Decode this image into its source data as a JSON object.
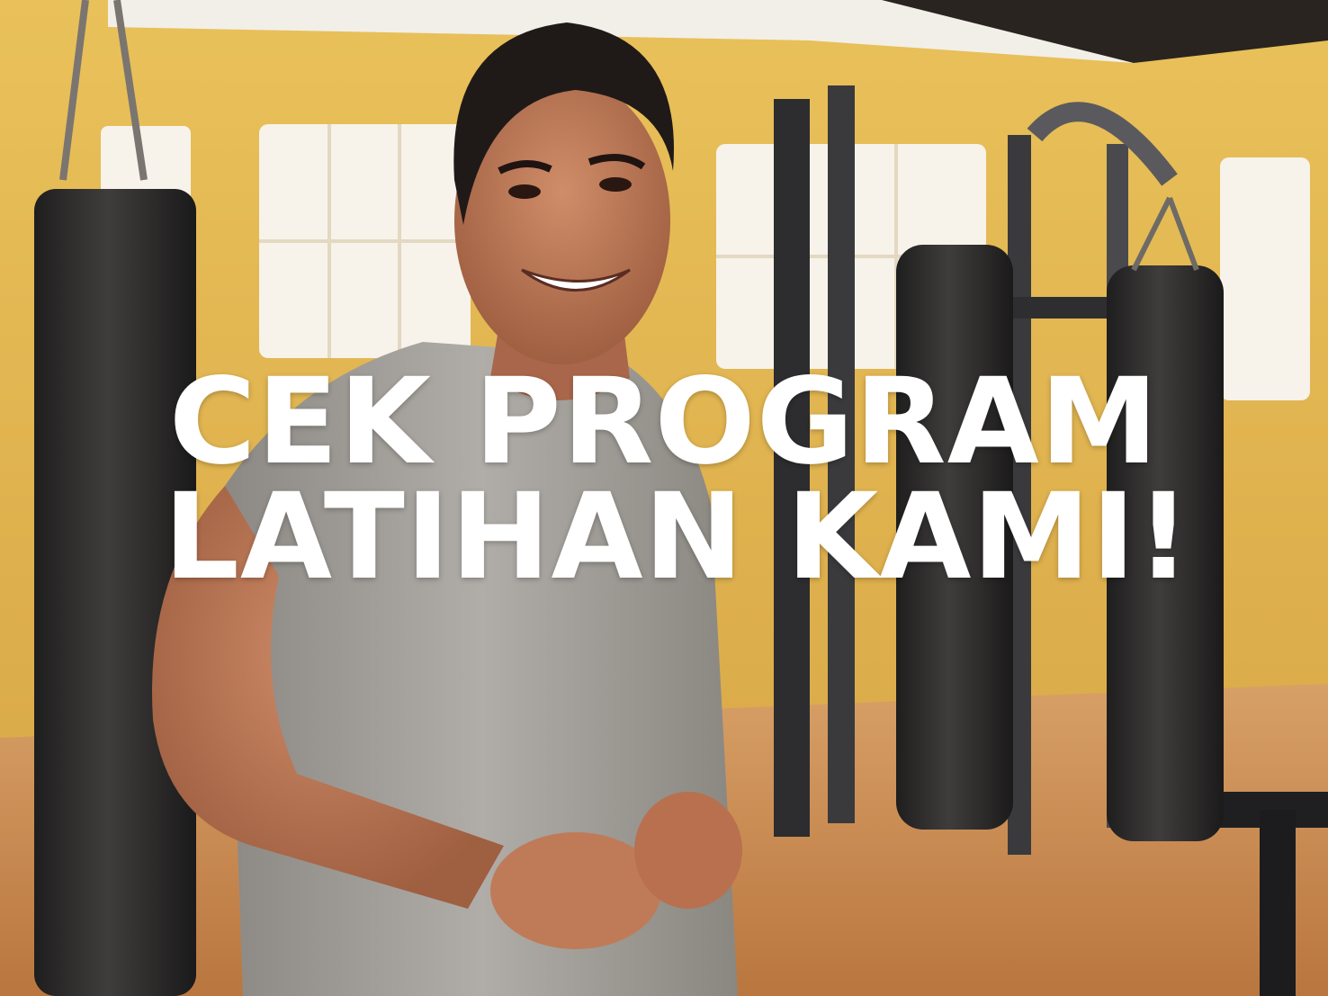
{
  "headline": {
    "line1": "CEK PROGRAM",
    "line2": "LATIHAN KAMI!"
  },
  "colors": {
    "wall": "#e3b748",
    "floor": "#c98a4e",
    "text": "#ffffff",
    "bag": "#2b2a2a",
    "shirt": "#9c9995",
    "skin": "#b87555"
  },
  "scene": {
    "subject": "smiling man in grey tank top in a gym",
    "objects": [
      "punching-bag",
      "weight-machine",
      "windows",
      "wooden-floor"
    ]
  }
}
